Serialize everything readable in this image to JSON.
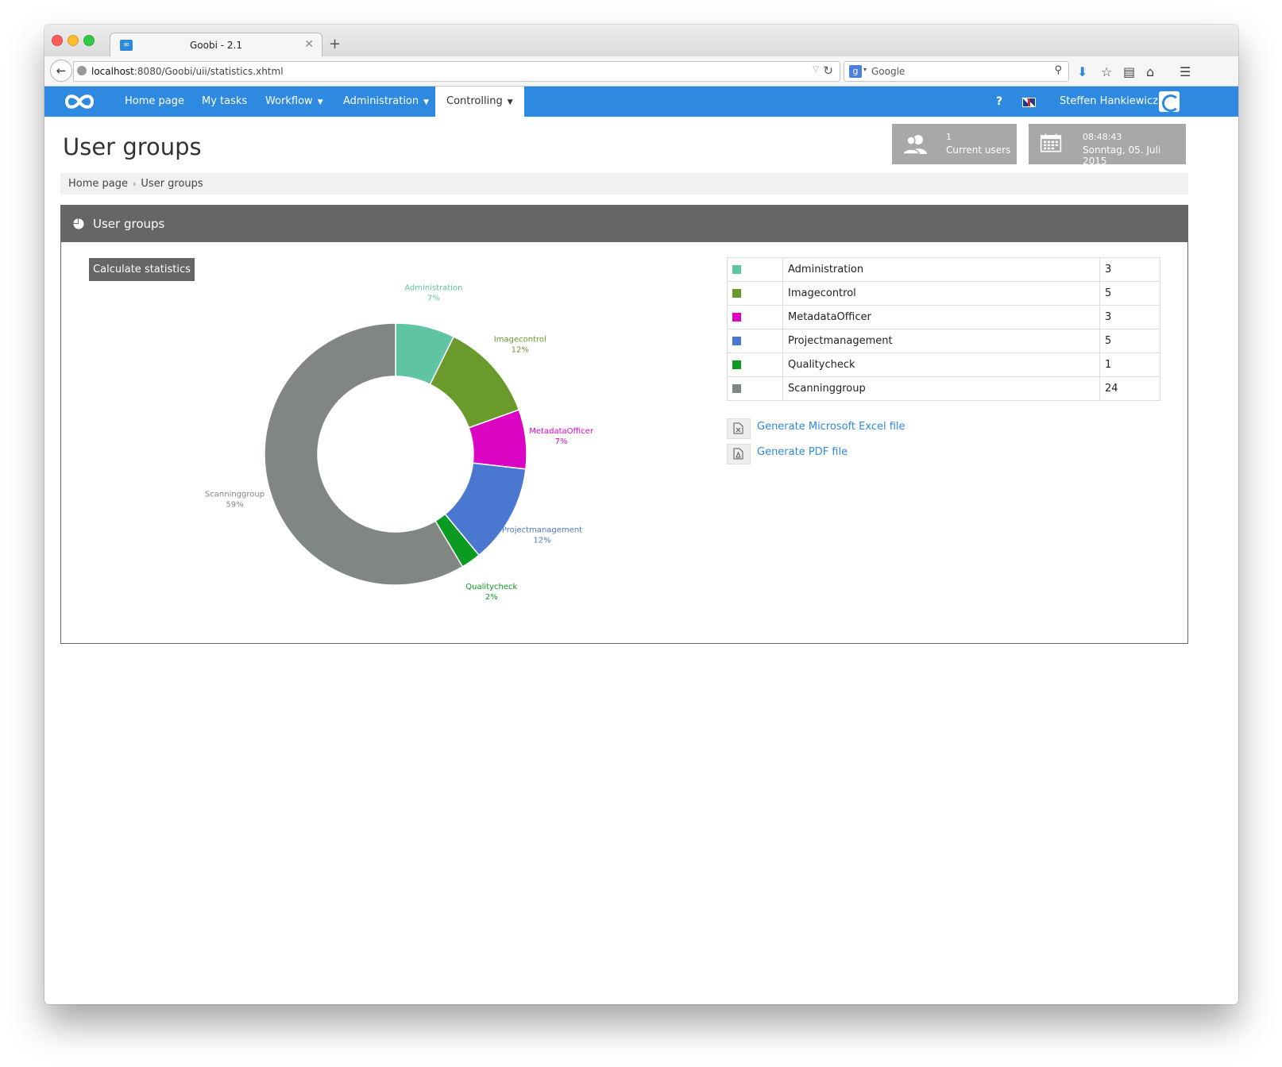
{
  "browser": {
    "tab_title": "Goobi - 2.1",
    "url_host": "localhost",
    "url_rest": ":8080/Goobi/uii/statistics.xhtml",
    "search_placeholder": "Google"
  },
  "nav": {
    "items": [
      {
        "label": "Home page",
        "dropdown": false,
        "active": false
      },
      {
        "label": "My tasks",
        "dropdown": false,
        "active": false
      },
      {
        "label": "Workflow",
        "dropdown": true,
        "active": false
      },
      {
        "label": "Administration",
        "dropdown": true,
        "active": false
      },
      {
        "label": "Controlling",
        "dropdown": true,
        "active": true
      }
    ],
    "help": "?",
    "user_name": "Steffen Hankiewicz",
    "brand_color": "#2e8ae0"
  },
  "page": {
    "title": "User groups",
    "current_users_count": "1",
    "current_users_label": "Current users",
    "time": "08:48:43",
    "date": "Sonntag, 05. Juli 2015"
  },
  "breadcrumb": {
    "home": "Home page",
    "current": "User groups"
  },
  "panel": {
    "title": "User groups",
    "calc_button": "Calculate statistics",
    "excel_link": "Generate Microsoft Excel file",
    "pdf_link": "Generate PDF file"
  },
  "chart_data": {
    "type": "pie",
    "donut": true,
    "categories": [
      "Administration",
      "Imagecontrol",
      "MetadataOfficer",
      "Projectmanagement",
      "Qualitycheck",
      "Scanninggroup"
    ],
    "values": [
      3,
      5,
      3,
      5,
      1,
      24
    ],
    "percent_labels": [
      "7%",
      "12%",
      "7%",
      "12%",
      "2%",
      "59%"
    ],
    "colors": [
      "#5ec4a3",
      "#6a992c",
      "#dc05c4",
      "#4a78d0",
      "#0c9b22",
      "#808681"
    ]
  }
}
